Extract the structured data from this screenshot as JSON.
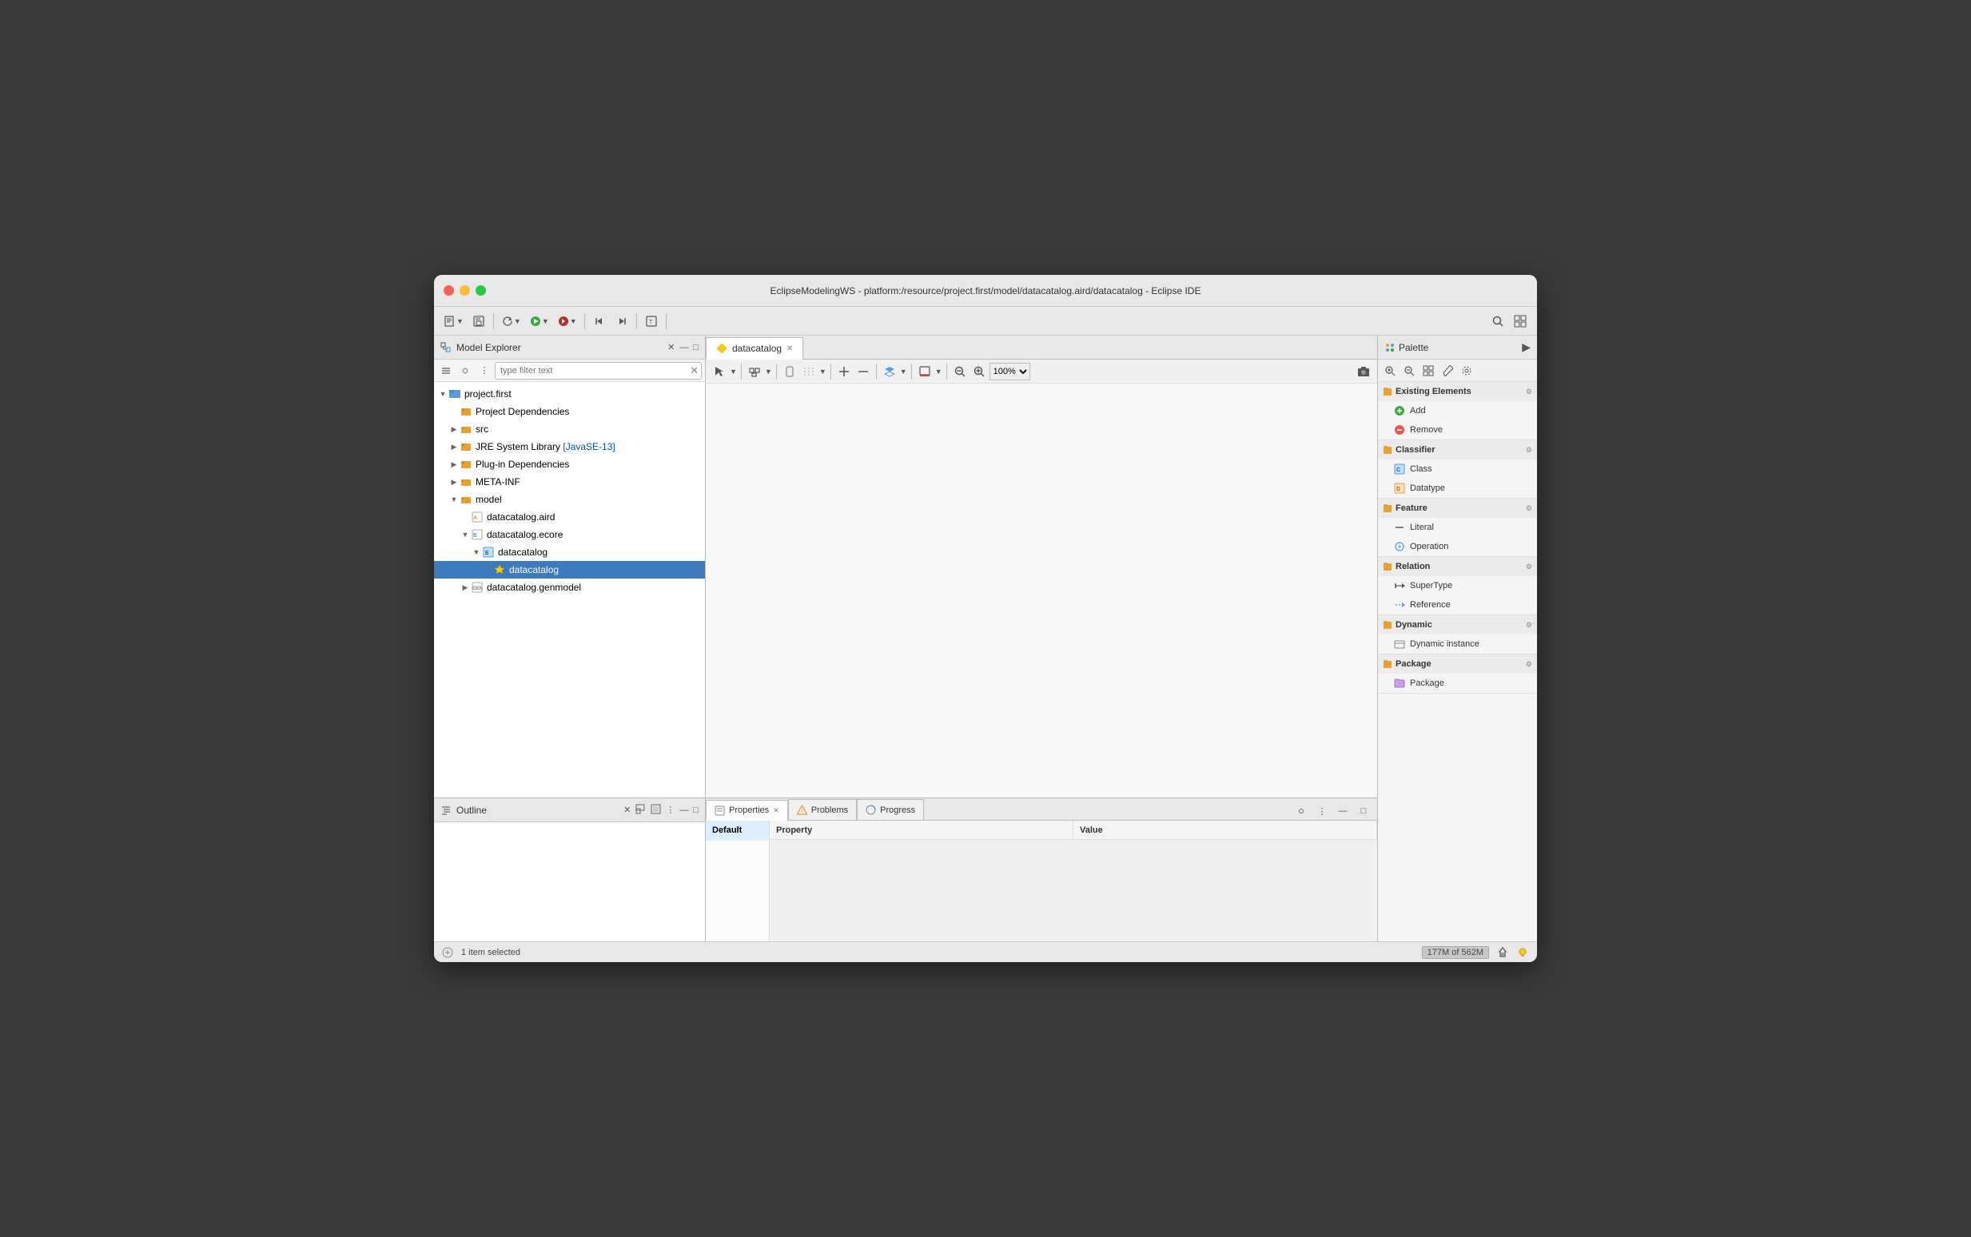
{
  "window": {
    "title": "EclipseModelingWS - platform:/resource/project.first/model/datacatalog.aird/datacatalog - Eclipse IDE"
  },
  "toolbar": {
    "buttons": [
      "📁",
      "💾",
      "⟳",
      "▶",
      "⛔",
      "🔧",
      "🔍",
      "☰"
    ]
  },
  "model_explorer": {
    "title": "Model Explorer",
    "search_placeholder": "type filter text",
    "tree": [
      {
        "id": "project-first",
        "label": "project.first",
        "indent": 1,
        "type": "project",
        "expanded": true,
        "arrow": "▼"
      },
      {
        "id": "project-deps",
        "label": "Project Dependencies",
        "indent": 2,
        "type": "deps",
        "expanded": false,
        "arrow": ""
      },
      {
        "id": "src",
        "label": "src",
        "indent": 2,
        "type": "folder",
        "expanded": false,
        "arrow": "▶"
      },
      {
        "id": "jre",
        "label": "JRE System Library [JavaSE-13]",
        "indent": 2,
        "type": "lib",
        "expanded": false,
        "arrow": "▶"
      },
      {
        "id": "plugin-deps",
        "label": "Plug-in Dependencies",
        "indent": 2,
        "type": "deps",
        "expanded": false,
        "arrow": "▶"
      },
      {
        "id": "meta-inf",
        "label": "META-INF",
        "indent": 2,
        "type": "folder",
        "expanded": false,
        "arrow": "▶"
      },
      {
        "id": "model",
        "label": "model",
        "indent": 2,
        "type": "folder",
        "expanded": true,
        "arrow": "▼"
      },
      {
        "id": "datacatalog-aird",
        "label": "datacatalog.aird",
        "indent": 3,
        "type": "aird",
        "expanded": false,
        "arrow": ""
      },
      {
        "id": "datacatalog-ecore",
        "label": "datacatalog.ecore",
        "indent": 3,
        "type": "ecore",
        "expanded": true,
        "arrow": "▼"
      },
      {
        "id": "datacatalog-inner",
        "label": "datacatalog",
        "indent": 4,
        "type": "ecore-inner",
        "expanded": true,
        "arrow": "▼"
      },
      {
        "id": "datacatalog-item",
        "label": "datacatalog",
        "indent": 5,
        "type": "star",
        "expanded": false,
        "arrow": "",
        "selected": true
      },
      {
        "id": "datacatalog-genmodel",
        "label": "datacatalog.genmodel",
        "indent": 3,
        "type": "genmodel",
        "expanded": false,
        "arrow": "▶"
      }
    ]
  },
  "outline": {
    "title": "Outline"
  },
  "editor": {
    "tab": "datacatalog",
    "close_icon": "✕"
  },
  "palette": {
    "title": "Palette",
    "toolbar_buttons": [
      "🔍+",
      "🔍-",
      "📋",
      "✏️",
      "☰"
    ],
    "sections": [
      {
        "id": "existing-elements",
        "title": "Existing Elements",
        "expanded": true,
        "items": [
          {
            "id": "add",
            "label": "Add",
            "icon": "add"
          },
          {
            "id": "remove",
            "label": "Remove",
            "icon": "remove"
          }
        ]
      },
      {
        "id": "classifier",
        "title": "Classifier",
        "expanded": true,
        "items": [
          {
            "id": "class",
            "label": "Class",
            "icon": "class"
          },
          {
            "id": "datatype",
            "label": "Datatype",
            "icon": "datatype"
          }
        ]
      },
      {
        "id": "feature",
        "title": "Feature",
        "expanded": true,
        "items": [
          {
            "id": "literal",
            "label": "Literal",
            "icon": "literal"
          },
          {
            "id": "operation",
            "label": "Operation",
            "icon": "operation"
          }
        ]
      },
      {
        "id": "relation",
        "title": "Relation",
        "expanded": true,
        "items": [
          {
            "id": "supertype",
            "label": "SuperType",
            "icon": "supertype"
          },
          {
            "id": "reference",
            "label": "Reference",
            "icon": "reference"
          }
        ]
      },
      {
        "id": "dynamic",
        "title": "Dynamic",
        "expanded": true,
        "items": [
          {
            "id": "dynamic-instance",
            "label": "Dynamic instance",
            "icon": "dynamic"
          }
        ]
      },
      {
        "id": "package",
        "title": "Package",
        "expanded": true,
        "items": [
          {
            "id": "package",
            "label": "Package",
            "icon": "package"
          }
        ]
      }
    ]
  },
  "properties": {
    "tabs": [
      {
        "id": "properties",
        "label": "Properties",
        "active": true
      },
      {
        "id": "problems",
        "label": "Problems"
      },
      {
        "id": "progress",
        "label": "Progress"
      }
    ],
    "default_tab": "Default",
    "columns": {
      "property": "Property",
      "value": "Value"
    }
  },
  "statusbar": {
    "selection": "1 item selected",
    "memory": "177M of 562M"
  }
}
